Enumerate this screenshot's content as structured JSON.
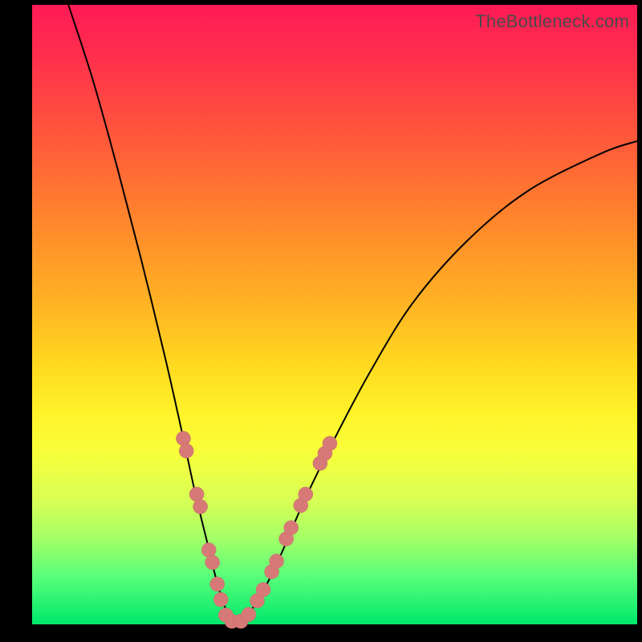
{
  "attribution": "TheBottleneck.com",
  "chart_data": {
    "type": "line",
    "title": "",
    "xlabel": "",
    "ylabel": "",
    "xlim": [
      0,
      100
    ],
    "ylim": [
      0,
      100
    ],
    "background_gradient": {
      "top": "#ff1a55",
      "mid1": "#ff8a2b",
      "mid2": "#fff32a",
      "bottom": "#00e86b"
    },
    "series": [
      {
        "name": "bottleneck-curve",
        "color": "#000000",
        "x": [
          6,
          10,
          14,
          18,
          22,
          25,
          27,
          29,
          30.5,
          31.8,
          33,
          34.5,
          36,
          38,
          41,
          45,
          50,
          56,
          63,
          72,
          82,
          94,
          100
        ],
        "y": [
          100,
          88,
          74,
          59,
          43,
          30,
          21,
          13,
          7,
          3,
          0.5,
          0.5,
          2,
          5,
          11,
          20,
          30,
          41,
          52,
          62,
          70,
          76,
          78
        ]
      }
    ],
    "markers": {
      "name": "highlight-beads",
      "color": "#d77a77",
      "radius_px": 9,
      "points": [
        {
          "x": 25.0,
          "y": 30
        },
        {
          "x": 25.5,
          "y": 28
        },
        {
          "x": 27.2,
          "y": 21
        },
        {
          "x": 27.8,
          "y": 19
        },
        {
          "x": 29.2,
          "y": 12
        },
        {
          "x": 29.8,
          "y": 10
        },
        {
          "x": 30.6,
          "y": 6.5
        },
        {
          "x": 31.2,
          "y": 4
        },
        {
          "x": 32.0,
          "y": 1.5
        },
        {
          "x": 33.0,
          "y": 0.5
        },
        {
          "x": 34.5,
          "y": 0.5
        },
        {
          "x": 35.8,
          "y": 1.6
        },
        {
          "x": 37.2,
          "y": 3.8
        },
        {
          "x": 38.2,
          "y": 5.6
        },
        {
          "x": 39.6,
          "y": 8.5
        },
        {
          "x": 40.4,
          "y": 10.2
        },
        {
          "x": 42.0,
          "y": 13.8
        },
        {
          "x": 42.8,
          "y": 15.6
        },
        {
          "x": 44.4,
          "y": 19.2
        },
        {
          "x": 45.2,
          "y": 21.0
        },
        {
          "x": 47.6,
          "y": 26.0
        },
        {
          "x": 48.4,
          "y": 27.6
        },
        {
          "x": 49.2,
          "y": 29.2
        }
      ]
    }
  }
}
